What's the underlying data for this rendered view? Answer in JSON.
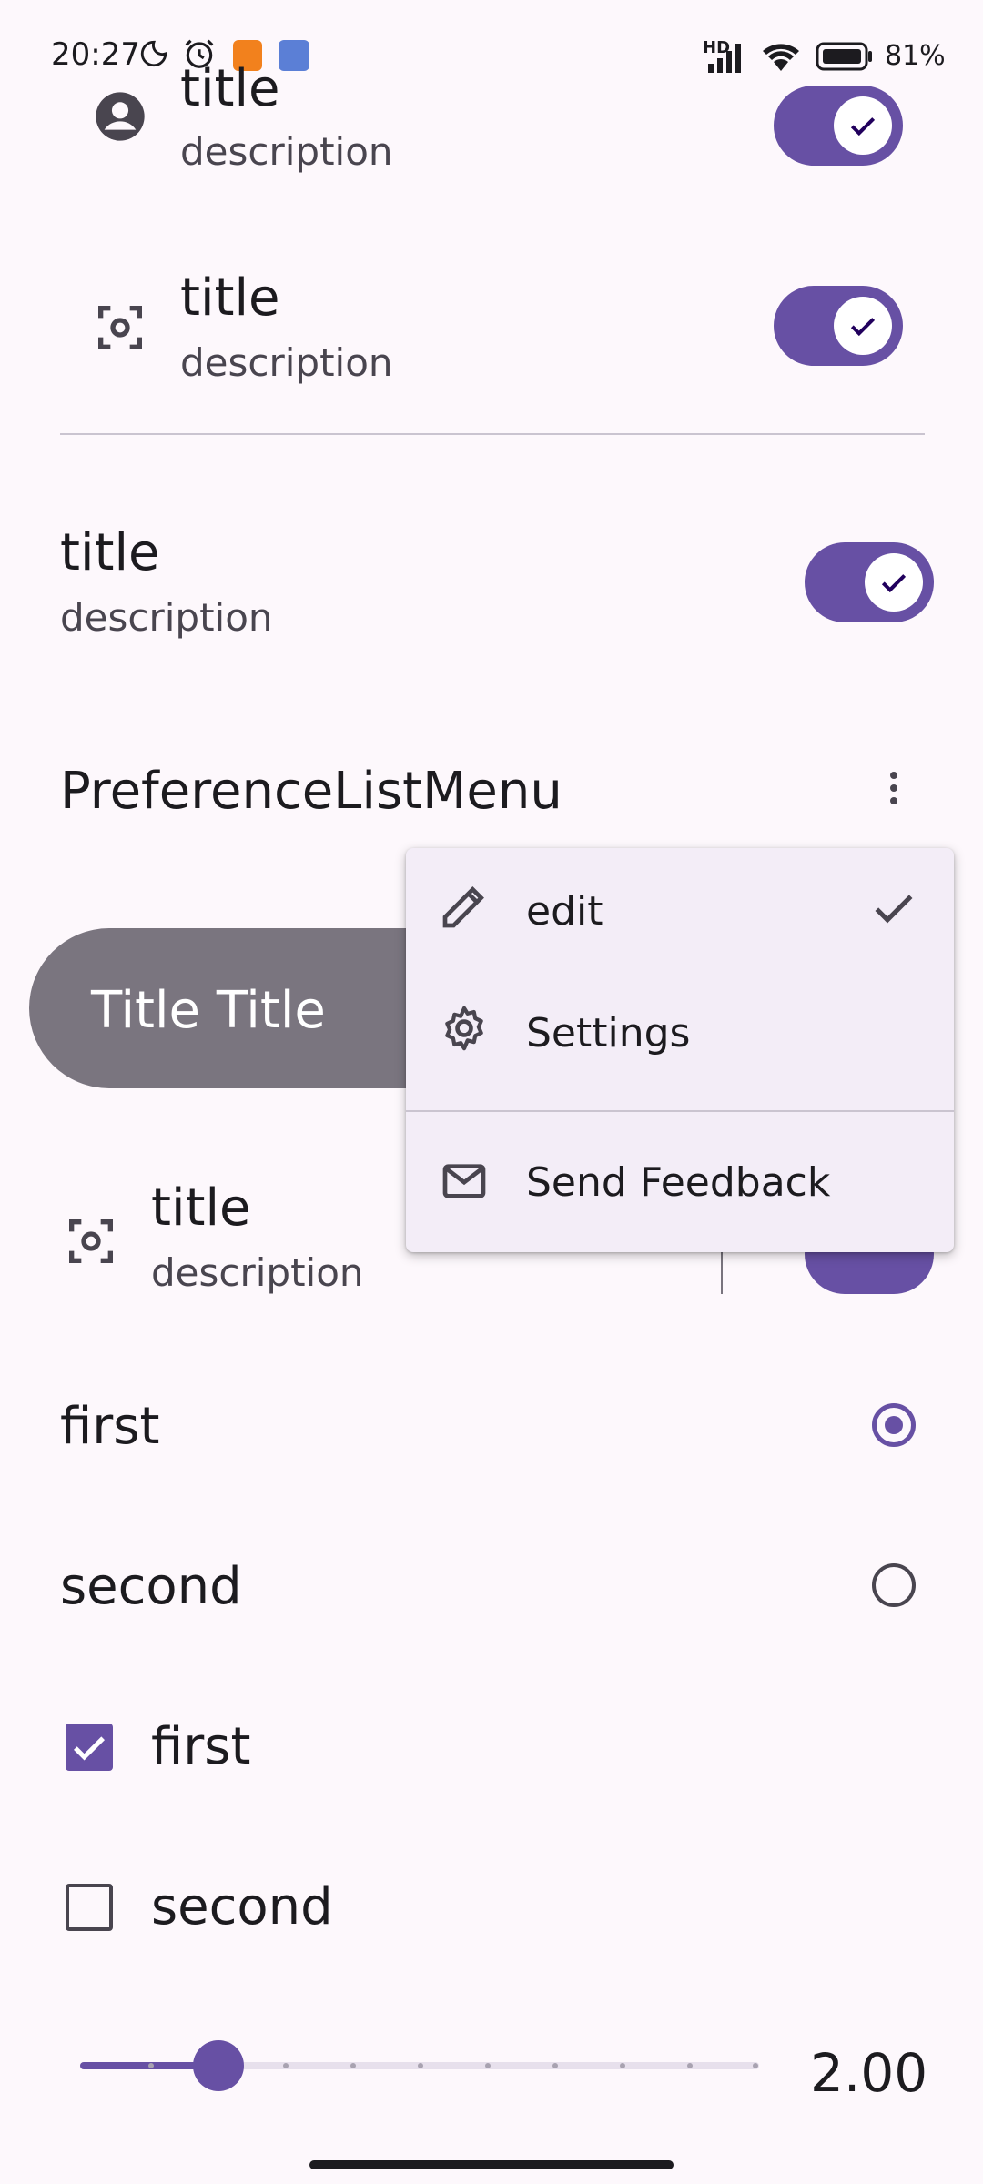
{
  "status_bar": {
    "time": "20:27",
    "network": "HD",
    "battery": "81%",
    "icons": [
      "moon-icon",
      "alarm-icon",
      "notification-app-icon",
      "notification-app-icon",
      "signal-icon",
      "wifi-icon",
      "battery-icon"
    ]
  },
  "prefs": {
    "item1": {
      "title": "title",
      "description": "description",
      "checked": true,
      "icon": "account-circle-icon"
    },
    "item2": {
      "title": "title",
      "description": "description",
      "checked": true,
      "icon": "center-focus-icon"
    },
    "item3": {
      "title": "title",
      "description": "description",
      "checked": true
    },
    "list_menu": {
      "title": "PreferenceListMenu",
      "icon": "more-vert-icon"
    },
    "pill_label": "Title Title",
    "item4": {
      "title": "title",
      "description": "description",
      "icon": "center-focus-icon"
    }
  },
  "dropdown_menu": {
    "items": [
      {
        "label": "edit",
        "icon": "pencil-icon",
        "selected": true
      },
      {
        "label": "Settings",
        "icon": "gear-icon",
        "selected": false
      },
      {
        "label": "Send Feedback",
        "icon": "mail-icon",
        "selected": false
      }
    ]
  },
  "radios": [
    {
      "label": "first",
      "selected": true
    },
    {
      "label": "second",
      "selected": false
    }
  ],
  "checkboxes": [
    {
      "label": "first",
      "checked": true
    },
    {
      "label": "second",
      "checked": false
    }
  ],
  "slider": {
    "value_label": "2.00",
    "fraction": 0.2
  },
  "colors": {
    "primary": "#6750a4",
    "surface": "#fdf8fc",
    "menu": "#f3edf7",
    "pill": "#7a757f"
  }
}
